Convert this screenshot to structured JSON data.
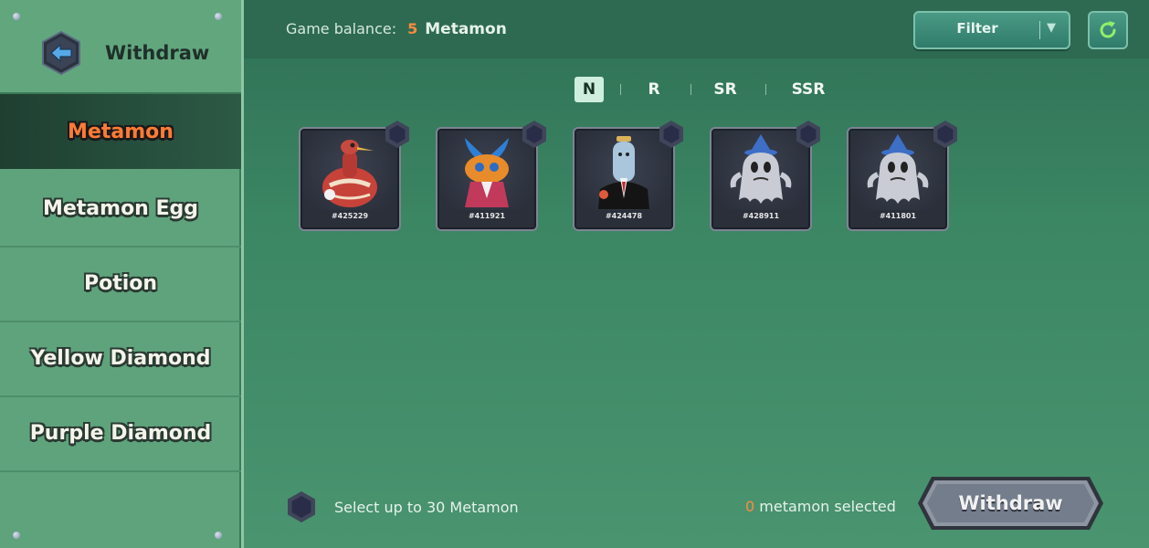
{
  "sidebar": {
    "header_title": "Withdraw",
    "items": [
      {
        "label": "Metamon",
        "active": true
      },
      {
        "label": "Metamon Egg",
        "active": false
      },
      {
        "label": "Potion",
        "active": false
      },
      {
        "label": "Yellow Diamond",
        "active": false
      },
      {
        "label": "Purple Diamond",
        "active": false
      }
    ]
  },
  "header": {
    "balance_label": "Game balance:",
    "balance_value": "5",
    "balance_unit": "Metamon",
    "filter_label": "Filter",
    "refresh_icon": "refresh-icon"
  },
  "tabs": [
    {
      "label": "N",
      "active": true
    },
    {
      "label": "R",
      "active": false
    },
    {
      "label": "SR",
      "active": false
    },
    {
      "label": "SSR",
      "active": false
    }
  ],
  "cards": [
    {
      "id": "#425229",
      "art": "gourd-bird-icon"
    },
    {
      "id": "#411921",
      "art": "horned-creature-icon"
    },
    {
      "id": "#424478",
      "art": "suited-bottle-icon"
    },
    {
      "id": "#428911",
      "art": "ghost-wizard-icon"
    },
    {
      "id": "#411801",
      "art": "ghost-wizard-icon"
    }
  ],
  "footer": {
    "hint": "Select up to 30 Metamon",
    "selected_count": "0",
    "selected_suffix": "metamon selected",
    "withdraw_label": "Withdraw"
  },
  "colors": {
    "accent_orange": "#ff7b35",
    "sidebar_bg": "#5fa37c",
    "main_bg": "#3b8663",
    "card_bg": "#2a2f3a"
  }
}
